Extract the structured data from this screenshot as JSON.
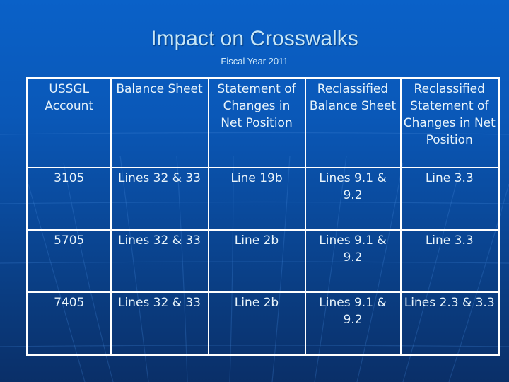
{
  "slide": {
    "title": "Impact on Crosswalks",
    "subtitle": "Fiscal Year 2011"
  },
  "table": {
    "headers": [
      "USSGL Account",
      "Balance Sheet",
      "Statement of Changes in Net Position",
      "Reclassified Balance Sheet",
      "Reclassified Statement of Changes in Net Position"
    ],
    "rows": [
      [
        "3105",
        "Lines 32 & 33",
        "Line 19b",
        "Lines 9.1 & 9.2",
        "Line 3.3"
      ],
      [
        "5705",
        "Lines 32 & 33",
        "Line 2b",
        "Lines 9.1 & 9.2",
        "Line 3.3"
      ],
      [
        "7405",
        "Lines 32 & 33",
        "Line 2b",
        "Lines 9.1 & 9.2",
        "Lines 2.3 & 3.3"
      ]
    ]
  },
  "colors": {
    "background_top": "#0a61c8",
    "background_bottom": "#0a2f68",
    "title_text": "#c6e6f7",
    "table_border": "#ffffff",
    "cell_text": "#e8f4fb"
  }
}
